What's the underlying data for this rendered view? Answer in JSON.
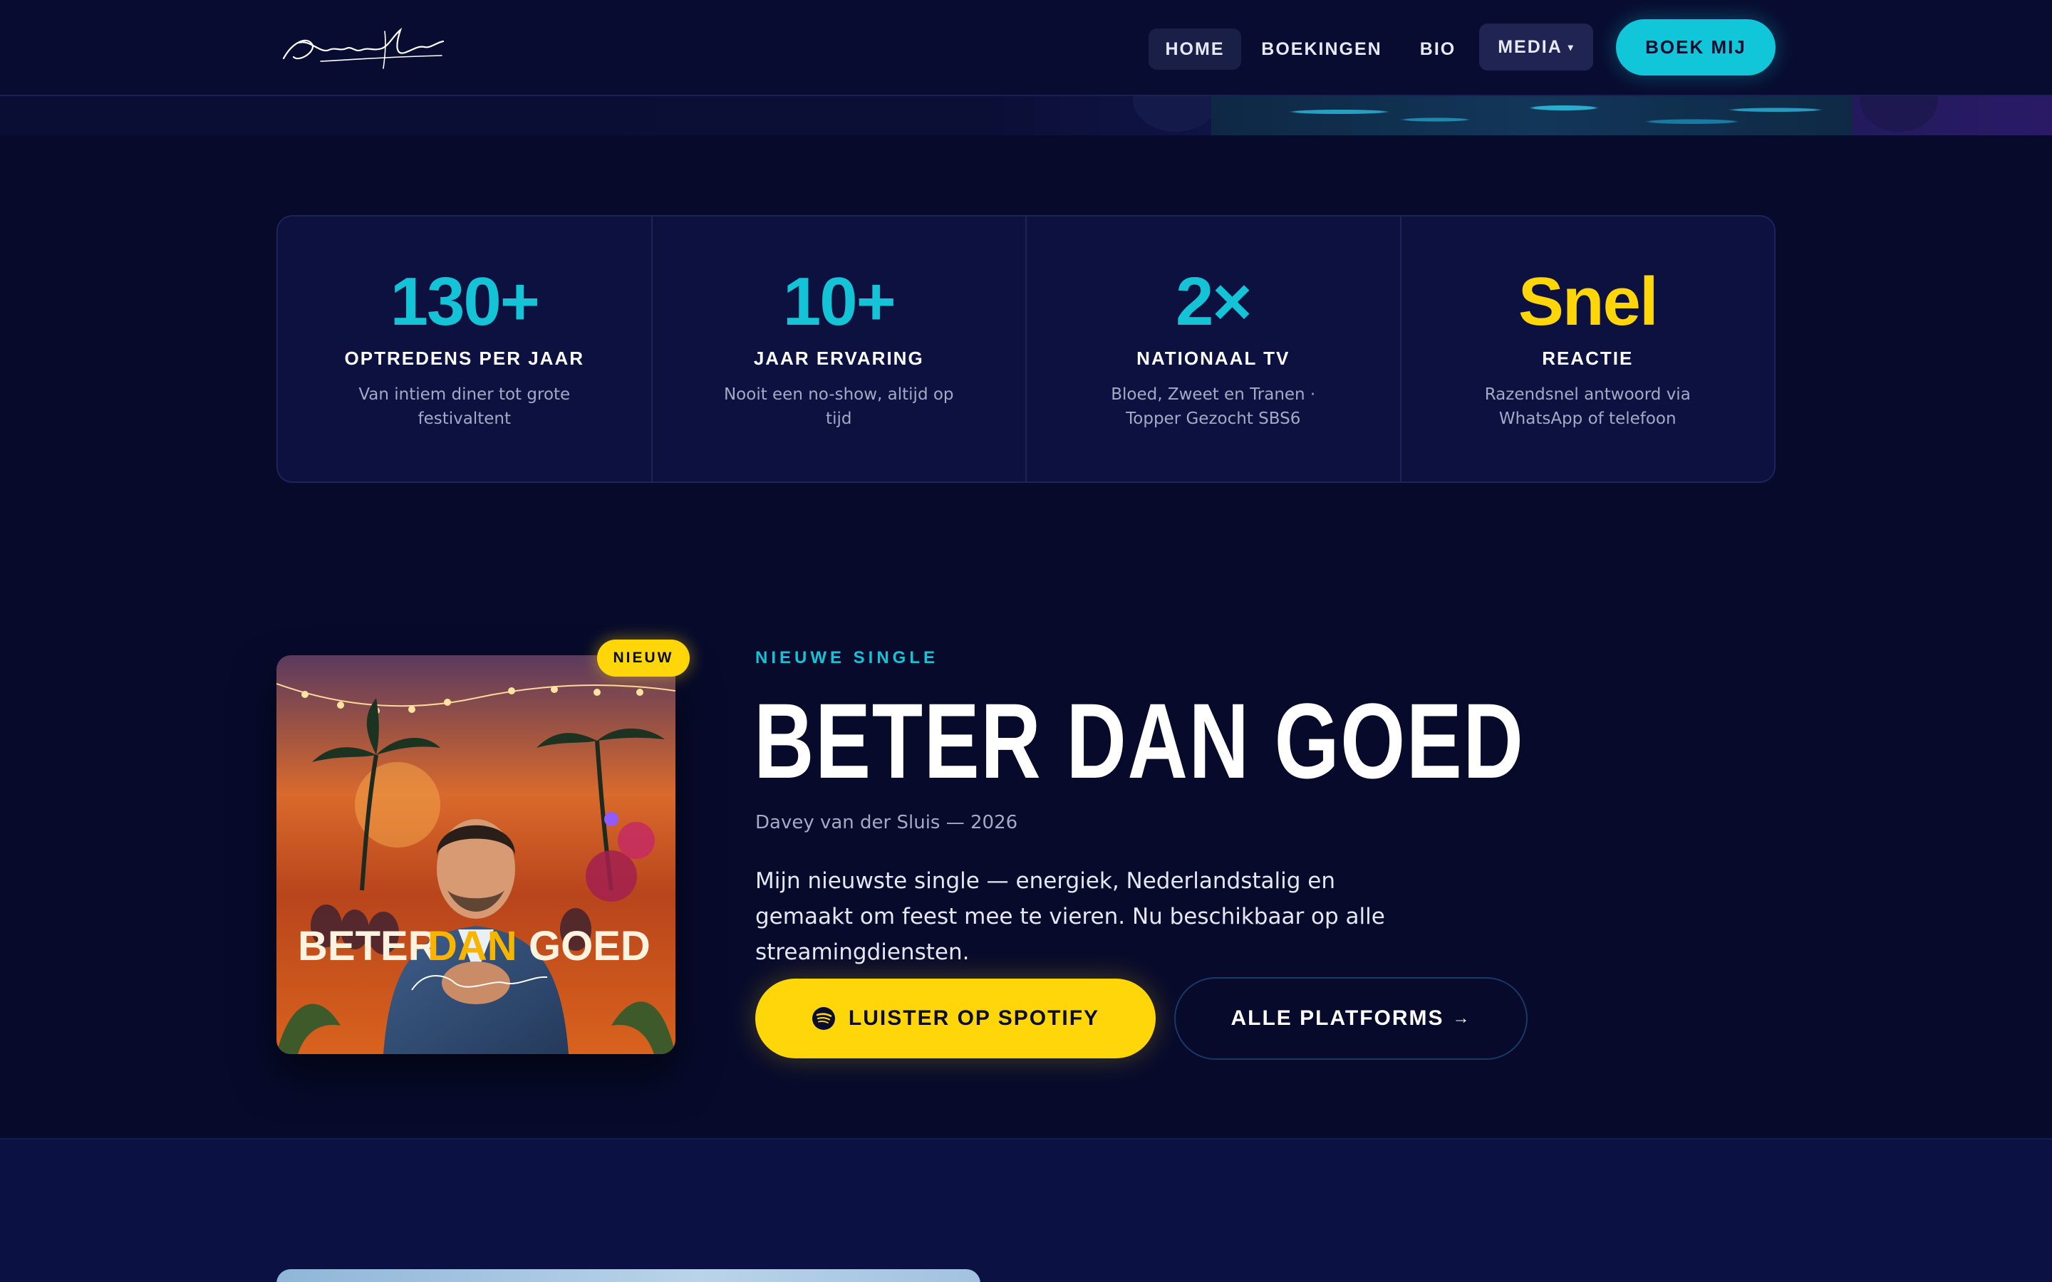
{
  "header": {
    "logo_alt": "Davey van der Sluis",
    "nav": {
      "home": "HOME",
      "boekingen": "BOEKINGEN",
      "bio": "BIO",
      "media": "MEDIA"
    },
    "cta": "BOEK MIJ"
  },
  "stats": [
    {
      "value": "130+",
      "label": "OPTREDENS PER JAAR",
      "desc": "Van intiem diner tot grote festivaltent",
      "color": "#14c3d6"
    },
    {
      "value": "10+",
      "label": "JAAR ERVARING",
      "desc": "Nooit een no-show, altijd op tijd",
      "color": "#14c3d6"
    },
    {
      "value": "2×",
      "label": "NATIONAAL TV",
      "desc": "Bloed, Zweet en Tranen · Topper Gezocht SBS6",
      "color": "#14c3d6"
    },
    {
      "value": "Snel",
      "label": "REACTIE",
      "desc": "Razendsnel antwoord via WhatsApp of telefoon",
      "color": "#ffd60a"
    }
  ],
  "single": {
    "badge": "NIEUW",
    "eyebrow": "NIEUWE SINGLE",
    "title": "BETER DAN GOED",
    "meta": "Davey van der Sluis — 2026",
    "description": "Mijn nieuwste single — energiek, Nederlandstalig en gemaakt om feest mee te vieren. Nu beschikbaar op alle streamingdiensten.",
    "cover_text": {
      "beter": "BETER",
      "dan": "DAN",
      "goed": "GOED"
    },
    "spotify_button": "LUISTER OP SPOTIFY",
    "platforms_button": "ALLE PLATFORMS",
    "platforms_arrow": "→"
  },
  "colors": {
    "accent_cyan": "#14c3d6",
    "accent_yellow": "#ffd60a",
    "background": "#070a2b"
  }
}
